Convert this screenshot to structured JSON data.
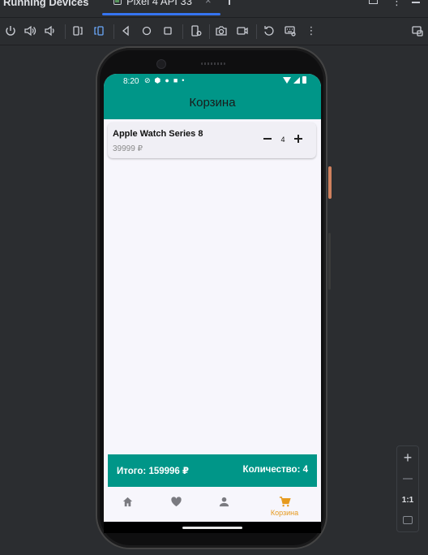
{
  "ide": {
    "panel_title": "Running Devices",
    "tab_label": "Pixel 4 API 33",
    "tab_close": "×"
  },
  "toolbar": {
    "icons": [
      "power-icon",
      "volume-up-icon",
      "volume-down-icon",
      "rotate-left-icon",
      "rotate-right-icon",
      "back-icon",
      "home-icon",
      "overview-icon",
      "device-settings-icon",
      "camera-icon",
      "screen-record-icon",
      "reset-icon",
      "keyboard-icon",
      "more-icon",
      "window-icon"
    ]
  },
  "status_bar": {
    "time": "8:20"
  },
  "app": {
    "title": "Корзина",
    "accent_color": "#009688",
    "active_color": "#e69a1e",
    "cart_items": [
      {
        "name": "Apple Watch Series 8",
        "price": "39999 ₽",
        "quantity": "4"
      }
    ],
    "summary": {
      "total": "Итого: 159996 ₽",
      "count": "Количество: 4"
    },
    "bottom_nav": [
      {
        "icon": "home-icon",
        "label": ""
      },
      {
        "icon": "heart-icon",
        "label": ""
      },
      {
        "icon": "person-icon",
        "label": ""
      },
      {
        "icon": "cart-icon",
        "label": "Корзина",
        "active": true
      }
    ]
  },
  "zoom": {
    "actual_size": "1:1"
  }
}
